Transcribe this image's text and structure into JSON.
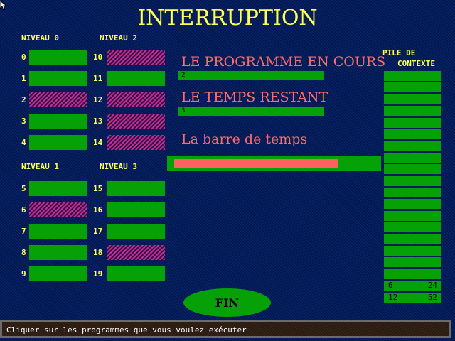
{
  "title": "INTERRUPTION",
  "levels": {
    "n0": "NIVEAU 0",
    "n1": "NIVEAU 1",
    "n2": "NIVEAU 2",
    "n3": "NIVEAU 3"
  },
  "programs": [
    {
      "num": "0",
      "selected": false
    },
    {
      "num": "1",
      "selected": false
    },
    {
      "num": "2",
      "selected": true
    },
    {
      "num": "3",
      "selected": false
    },
    {
      "num": "4",
      "selected": false
    },
    {
      "num": "5",
      "selected": false
    },
    {
      "num": "6",
      "selected": true
    },
    {
      "num": "7",
      "selected": false
    },
    {
      "num": "8",
      "selected": false
    },
    {
      "num": "9",
      "selected": false
    },
    {
      "num": "10",
      "selected": true
    },
    {
      "num": "11",
      "selected": false
    },
    {
      "num": "12",
      "selected": true
    },
    {
      "num": "13",
      "selected": true
    },
    {
      "num": "14",
      "selected": true
    },
    {
      "num": "15",
      "selected": false
    },
    {
      "num": "16",
      "selected": false
    },
    {
      "num": "17",
      "selected": false
    },
    {
      "num": "18",
      "selected": true
    },
    {
      "num": "19",
      "selected": false
    }
  ],
  "current_program": {
    "heading": "LE PROGRAMME EN COURS",
    "value": "2"
  },
  "time_remaining": {
    "heading": "LE TEMPS RESTANT",
    "value": "3"
  },
  "time_bar": {
    "heading": "La barre de temps",
    "fill_fraction": 0.82
  },
  "context_stack": {
    "label_line1": "PILE DE",
    "label_line2": "CONTEXTE",
    "entries": [
      {
        "a": "6",
        "b": "24"
      },
      {
        "a": "12",
        "b": "52"
      }
    ]
  },
  "fin_button": "FIN",
  "status_message": "Cliquer sur les programmes que vous voulez exécuter",
  "colors": {
    "background": "#001a5c",
    "title": "#ffff55",
    "heading": "#ff6b6b",
    "green": "#06a106",
    "selected_hatch": "#cc2a8c",
    "time_fill": "#ff6060"
  }
}
